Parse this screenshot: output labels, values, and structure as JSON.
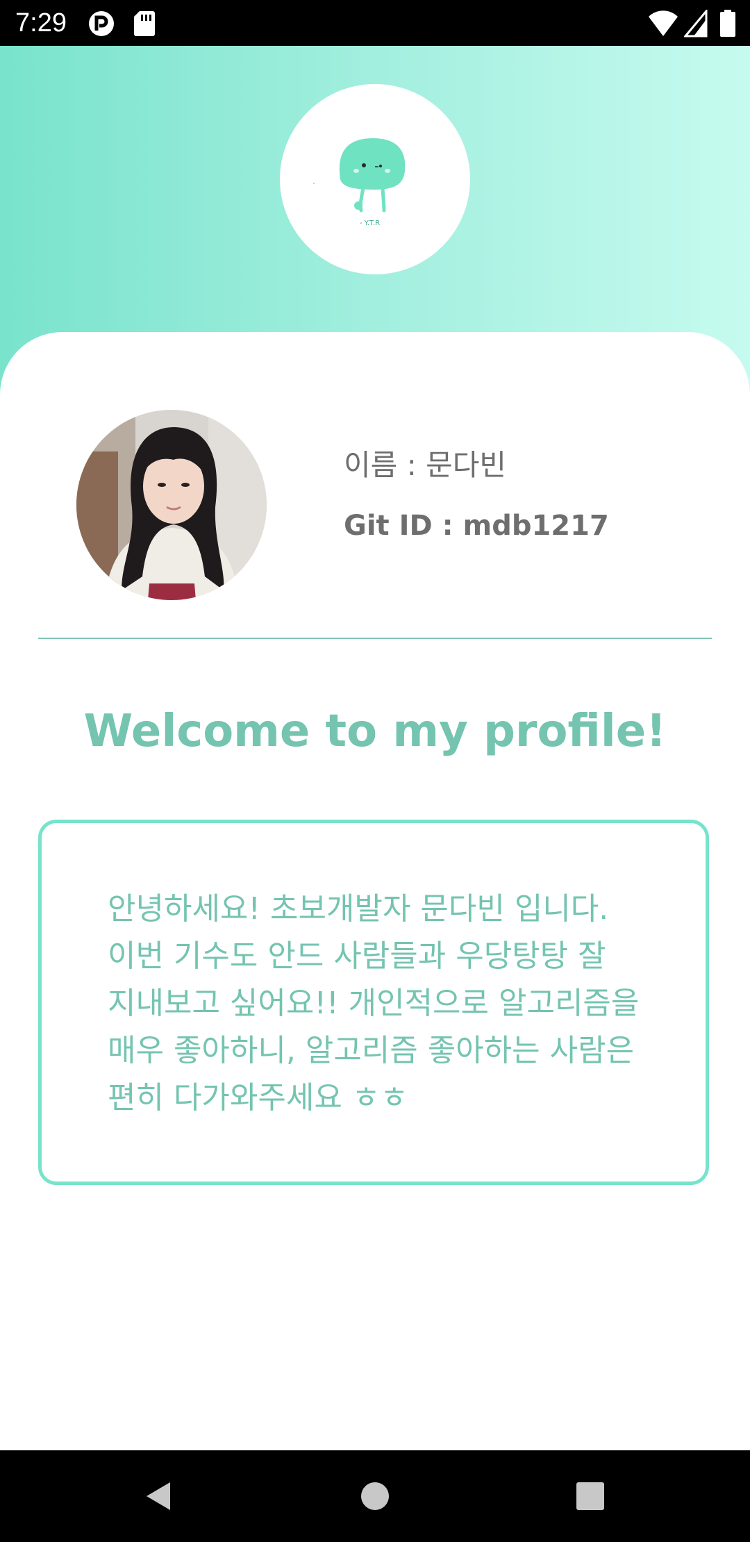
{
  "status_bar": {
    "time": "7:29",
    "left_icons": [
      "app-notification-icon",
      "sd-card-icon"
    ],
    "right_icons": [
      "wifi-icon",
      "cell-signal-icon",
      "battery-icon"
    ]
  },
  "header": {
    "logo_icon": "mascot-logo-icon",
    "logo_text": "- Y.T.R",
    "gradient_colors": [
      "#79e3cc",
      "#a6f0e0",
      "#c6fbef"
    ]
  },
  "profile": {
    "avatar_icon": "profile-photo",
    "name": "이름 : 문다빈",
    "git_id": "Git ID : mdb1217"
  },
  "welcome": "Welcome to my profile!",
  "intro": "안녕하세요! 초보개발자 문다빈 입니다. 이번 기수도 안드 사람들과 우당탕탕 잘 지내보고 싶어요!! 개인적으로 알고리즘을 매우 좋아하니, 알고리즘 좋아하는 사람은 편히 다가와주세요 ㅎㅎ",
  "colors": {
    "accent": "#74c4b0",
    "border": "#77e3cc",
    "text_gray": "#6e6e6e"
  },
  "nav_bar": {
    "buttons": [
      "back-icon",
      "home-icon",
      "recents-icon"
    ]
  }
}
